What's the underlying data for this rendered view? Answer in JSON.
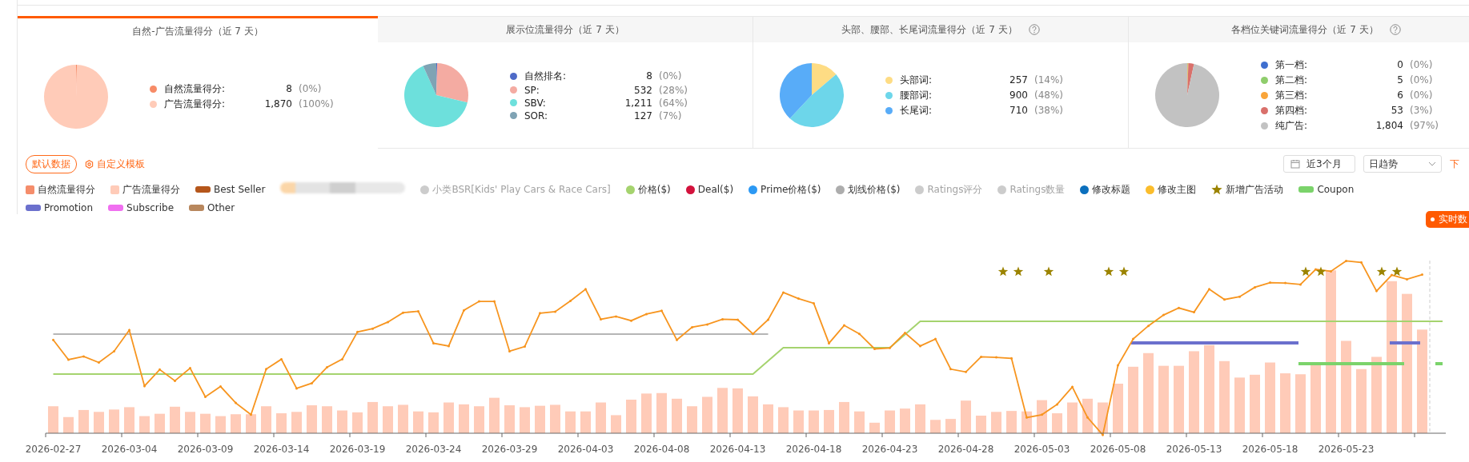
{
  "cards": [
    {
      "title": "自然-广告流量得分（近 7 天）",
      "selected": true,
      "help": false,
      "items": [
        {
          "label": "自然流量得分:",
          "value": "8",
          "percent": "(0%)",
          "color": "#f78b67"
        },
        {
          "label": "广告流量得分:",
          "value": "1,870",
          "percent": "(100%)",
          "color": "#ffcbb8"
        }
      ]
    },
    {
      "title": "展示位流量得分（近 7 天）",
      "selected": false,
      "help": false,
      "items": [
        {
          "label": "自然排名:",
          "value": "8",
          "percent": "(0%)",
          "color": "#4e6ac7"
        },
        {
          "label": "SP:",
          "value": "532",
          "percent": "(28%)",
          "color": "#f4aba2"
        },
        {
          "label": "SBV:",
          "value": "1,211",
          "percent": "(64%)",
          "color": "#6de0dc"
        },
        {
          "label": "SOR:",
          "value": "127",
          "percent": "(7%)",
          "color": "#7fa3b4"
        }
      ]
    },
    {
      "title": "头部、腰部、长尾词流量得分（近 7 天）",
      "selected": false,
      "help": true,
      "items": [
        {
          "label": "头部词:",
          "value": "257",
          "percent": "(14%)",
          "color": "#fedc84"
        },
        {
          "label": "腰部词:",
          "value": "900",
          "percent": "(48%)",
          "color": "#6dd6ea"
        },
        {
          "label": "长尾词:",
          "value": "710",
          "percent": "(38%)",
          "color": "#58acf8"
        }
      ]
    },
    {
      "title": "各档位关键词流量得分（近 7 天）",
      "selected": false,
      "help": true,
      "items": [
        {
          "label": "第一档:",
          "value": "0",
          "percent": "(0%)",
          "color": "#3f6fcf"
        },
        {
          "label": "第二档:",
          "value": "5",
          "percent": "(0%)",
          "color": "#8fcd6c"
        },
        {
          "label": "第三档:",
          "value": "6",
          "percent": "(0%)",
          "color": "#f9a53a"
        },
        {
          "label": "第四档:",
          "value": "53",
          "percent": "(3%)",
          "color": "#d9706b"
        },
        {
          "label": "纯广告:",
          "value": "1,804",
          "percent": "(97%)",
          "color": "#c2c2c2"
        }
      ]
    }
  ],
  "toolbar": {
    "default_button": "默认数据",
    "template_link": "自定义模板",
    "date_range": "近3个月",
    "granularity": "日趋势",
    "cut_link": "下"
  },
  "legend": [
    {
      "kind": "square",
      "label": "自然流量得分",
      "color": "#f58d6b",
      "disabled": false
    },
    {
      "kind": "square",
      "label": "广告流量得分",
      "color": "#ffcbb8",
      "disabled": false
    },
    {
      "kind": "bar",
      "label": "Best Seller",
      "color": "#b5561b",
      "disabled": false
    },
    {
      "kind": "redacted"
    },
    {
      "kind": "dot",
      "label": "小类BSR[Kids' Play Cars & Race Cars]",
      "color": "#cccccc",
      "disabled": true
    },
    {
      "kind": "dot",
      "label": "价格($)",
      "color": "#a5d36e",
      "disabled": false
    },
    {
      "kind": "dot",
      "label": "Deal($)",
      "color": "#d3123c",
      "disabled": false
    },
    {
      "kind": "dot",
      "label": "Prime价格($)",
      "color": "#2c99f4",
      "disabled": false
    },
    {
      "kind": "dot",
      "label": "划线价格($)",
      "color": "#adadad",
      "disabled": false
    },
    {
      "kind": "dot",
      "label": "Ratings评分",
      "color": "#cccccc",
      "disabled": true
    },
    {
      "kind": "dot",
      "label": "Ratings数量",
      "color": "#cccccc",
      "disabled": true
    },
    {
      "kind": "dot",
      "label": "修改标题",
      "color": "#0b6fbd",
      "disabled": false
    },
    {
      "kind": "dot",
      "label": "修改主图",
      "color": "#fbbd2c",
      "disabled": false
    },
    {
      "kind": "star",
      "label": "新增广告活动",
      "color": "#9b8300",
      "disabled": false
    },
    {
      "kind": "bar",
      "label": "Coupon",
      "color": "#7bd36b",
      "disabled": false
    },
    {
      "kind": "bar",
      "label": "Promotion",
      "color": "#6b70cd",
      "disabled": false
    },
    {
      "kind": "bar",
      "label": "Subscribe",
      "color": "#f06ff0",
      "disabled": false
    },
    {
      "kind": "bar",
      "label": "Other",
      "color": "#b8875d",
      "disabled": false
    }
  ],
  "realtime_badge": "实时数",
  "x_labels": [
    "2026-02-27",
    "2026-03-04",
    "2026-03-09",
    "2026-03-14",
    "2026-03-19",
    "2026-03-24",
    "2026-03-29",
    "2026-04-03",
    "2026-04-08",
    "2026-04-13",
    "2026-04-18",
    "2026-04-23",
    "2026-04-28",
    "2026-05-03",
    "2026-05-08",
    "2026-05-13",
    "2026-05-18",
    "2026-05-23"
  ]
}
